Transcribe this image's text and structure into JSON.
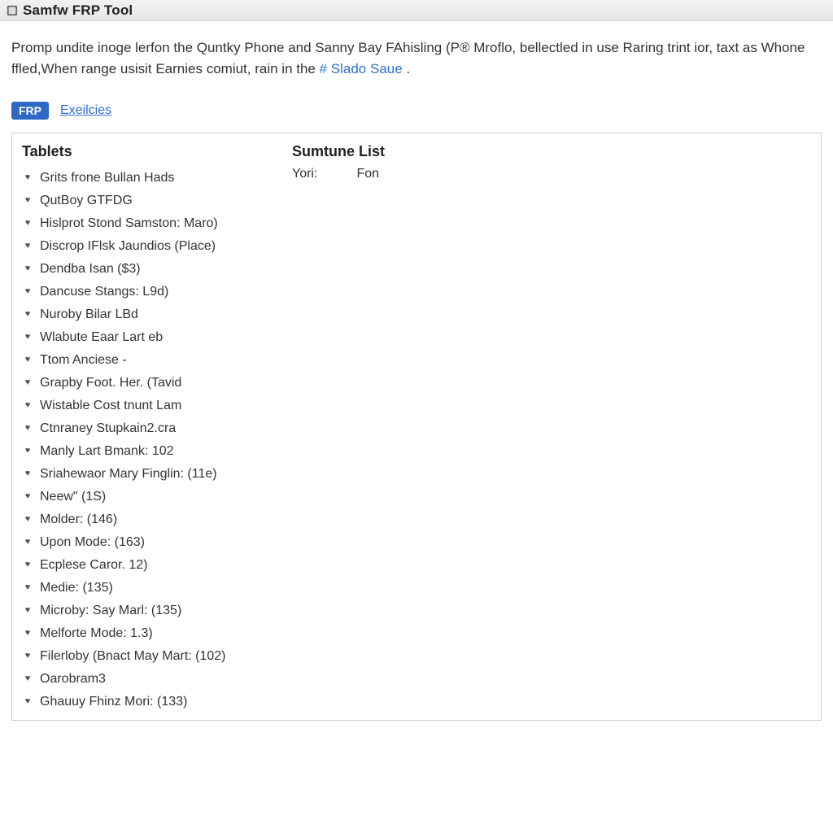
{
  "window": {
    "title": "Samfw FRP Tool"
  },
  "intro": {
    "pre": "Promp undite inoge lerfon the Quntky Phone and Sanny Bay FAhisling (P® Mroflo, bellectled in use Raring trint ior, taxt as Whone ffled,When range usisit Earnies comiut, rain in the ",
    "link": "# Slado Saue",
    "post": "."
  },
  "tabs": {
    "active": "FRP",
    "secondary": "Exeilcies"
  },
  "columns": {
    "left_header": "Tablets",
    "right_header": "Sumtune List"
  },
  "kv": {
    "key": "Yori:",
    "value": "Fon"
  },
  "devices": [
    "Grits frone Bullan Hads",
    "QutBoy GTFDG",
    "Hislprot Stond Samston: Maro)",
    "Discrop IFlsk Jaundios (Place)",
    "Dendba Isan ($3)",
    "Dancuse Stangs: L9d)",
    "Nuroby Bilar LBd",
    "Wlabute Eaar Lart eb",
    "Ttom Anciese -",
    "Grapby Foot. Her. (Tavid",
    "Wistable Cost tnunt Lam",
    "Ctnraney Stupkain2.cra",
    "Manly Lart Bmank: 102",
    "Sriahewaor Mary Finglin: (11e)",
    "Neew\" (1S)",
    "Molder: (146)",
    "Upon Mode: (163)",
    "Ecplese Caror. 12)",
    "Medie: (135)",
    "Microby: Say Marl: (135)",
    "Melforte Mode: 1.3)",
    "Filerloby (Bnact May Mart: (102)",
    "Oarobram3",
    "Ghauuy Fhinz Mori: (133)"
  ]
}
